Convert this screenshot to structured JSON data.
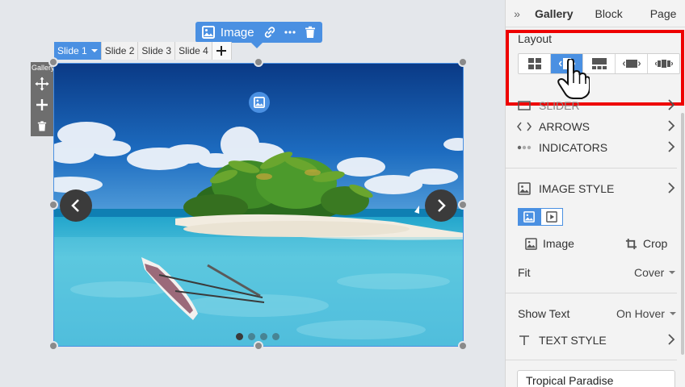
{
  "canvas": {
    "toolbar": {
      "label": "Image",
      "icons": [
        "image-icon",
        "link-icon",
        "more-icon",
        "trash-icon"
      ]
    },
    "slide_tabs": [
      {
        "label": "Slide 1",
        "active": true
      },
      {
        "label": "Slide 2",
        "active": false
      },
      {
        "label": "Slide 3",
        "active": false
      },
      {
        "label": "Slide 4",
        "active": false
      }
    ],
    "gallery_side": {
      "label": "Gallery",
      "icons": [
        "move-icon",
        "add-icon",
        "trash-icon"
      ]
    },
    "indicators": {
      "count": 4,
      "active_index": 0
    }
  },
  "panel": {
    "tabs": [
      "Gallery",
      "Block",
      "Page"
    ],
    "active_tab": "Gallery",
    "layout": {
      "label": "Layout",
      "options": [
        "grid-layout-icon",
        "slider-layout-icon",
        "tiles-layout-icon",
        "carousel-layout-icon",
        "filmstrip-layout-icon"
      ],
      "active_index": 1
    },
    "sections": {
      "slider": "SLIDER",
      "arrows": "ARROWS",
      "indicators": "INDICATORS",
      "image_style": "IMAGE STYLE",
      "text_style": "TEXT STYLE"
    },
    "image_options": {
      "image_label": "Image",
      "crop_label": "Crop"
    },
    "fit": {
      "label": "Fit",
      "value": "Cover"
    },
    "show_text": {
      "label": "Show Text",
      "value": "On Hover"
    },
    "title_input": {
      "value": "Tropical Paradise"
    },
    "colors": {
      "accent": "#4a90e2",
      "highlight": "#ee0000"
    }
  }
}
